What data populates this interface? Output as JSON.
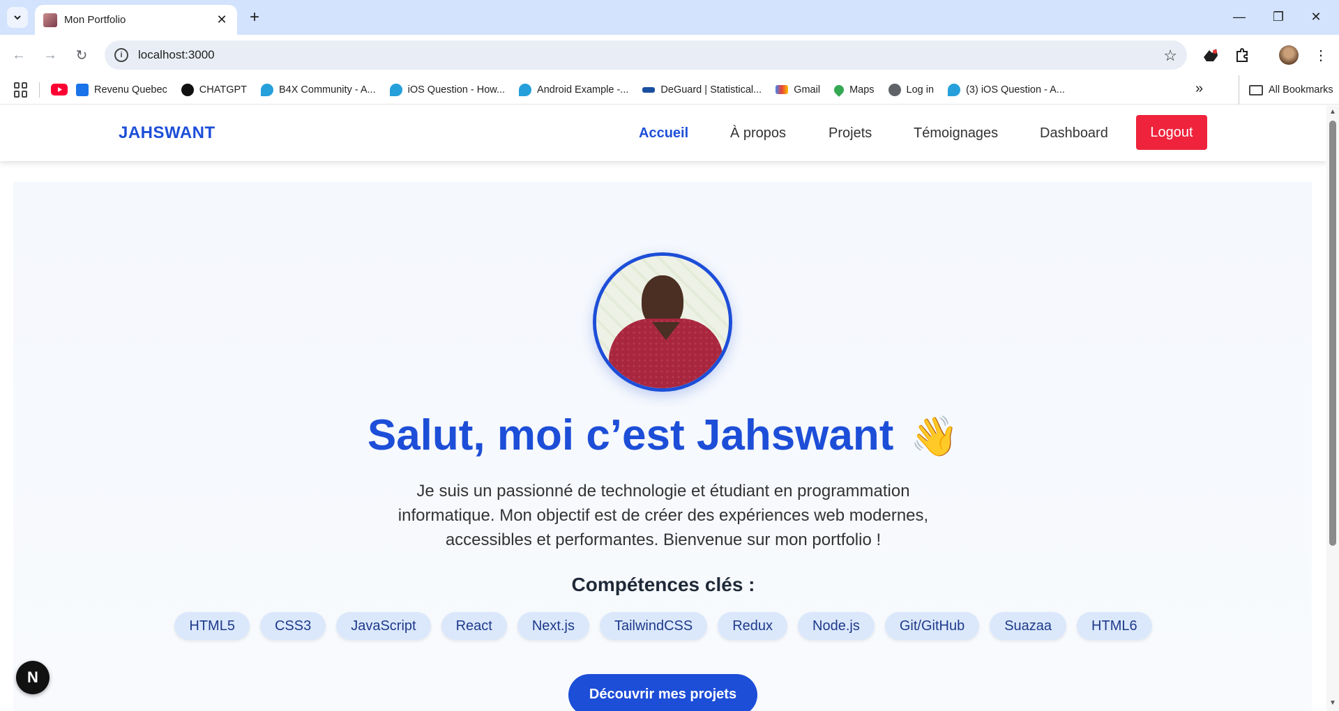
{
  "browser": {
    "tab_title": "Mon Portfolio",
    "url": "localhost:3000",
    "bookmarks": [
      {
        "label": "Revenu Quebec",
        "color": "#1a73e8"
      },
      {
        "label": "CHATGPT",
        "color": "#111111"
      },
      {
        "label": "B4X Community - A...",
        "color": "#26a0da"
      },
      {
        "label": "iOS Question - How...",
        "color": "#26a0da"
      },
      {
        "label": "Android Example -...",
        "color": "#26a0da"
      },
      {
        "label": "DeGuard | Statistical...",
        "color": "#1a4fa0"
      },
      {
        "label": "Gmail",
        "color": "#ea4335"
      },
      {
        "label": "Maps",
        "color": "#34a853"
      },
      {
        "label": "Log in",
        "color": "#5f6368"
      },
      {
        "label": "(3) iOS Question - A...",
        "color": "#26a0da"
      }
    ],
    "all_bookmarks": "All Bookmarks",
    "icons": [
      "tab-search-icon",
      "close-icon",
      "new-tab-icon",
      "minimize-icon",
      "restore-icon",
      "window-close-icon",
      "back-icon",
      "forward-icon",
      "reload-icon",
      "info-icon",
      "star-icon",
      "extension-icon",
      "puzzle-icon",
      "profile-avatar",
      "menu-icon",
      "apps-icon",
      "youtube-icon",
      "folder-icon",
      "chevron-double-right-icon"
    ]
  },
  "site": {
    "brand": "JAHSWANT",
    "nav": [
      "Accueil",
      "À propos",
      "Projets",
      "Témoignages",
      "Dashboard"
    ],
    "logout": "Logout",
    "colors": {
      "primary": "#1d4ed8",
      "logout": "#ef233c",
      "chip_bg": "#dbe8fb"
    }
  },
  "hero": {
    "title": "Salut, moi c’est Jahswant",
    "emoji": "👋",
    "description": "Je suis un passionné de technologie et étudiant en programmation informatique. Mon objectif est de créer des expériences web modernes, accessibles et performantes. Bienvenue sur mon portfolio !",
    "skills_title": "Compétences clés :",
    "skills": [
      "HTML5",
      "CSS3",
      "JavaScript",
      "React",
      "Next.js",
      "TailwindCSS",
      "Redux",
      "Node.js",
      "Git/GitHub",
      "Suazaa",
      "HTML6"
    ],
    "cta": "Découvrir mes projets"
  },
  "devtools": {
    "nextjs_badge": "N"
  }
}
